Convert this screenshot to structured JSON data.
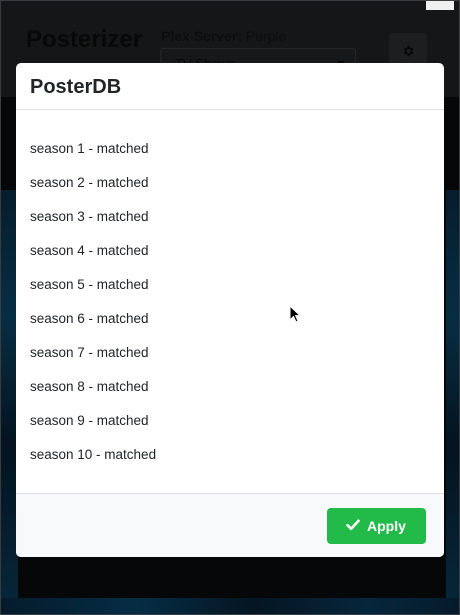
{
  "app": {
    "title": "Posterizer",
    "server_label": "Plex Server:",
    "server_name": "Purple",
    "library_select_value": "TV Shows"
  },
  "modal": {
    "title": "PosterDB",
    "items": [
      "season 1 - matched",
      "season 2 - matched",
      "season 3 - matched",
      "season 4 - matched",
      "season 5 - matched",
      "season 6 - matched",
      "season 7 - matched",
      "season 8 - matched",
      "season 9 - matched",
      "season 10 - matched"
    ],
    "apply_label": "Apply"
  },
  "icons": {
    "settings": "gear-icon",
    "apply": "check-icon",
    "cursor": "mouse-pointer-icon"
  },
  "colors": {
    "apply_button": "#22bb4a",
    "modal_background": "#ffffff",
    "footer_background": "#f8f9fa"
  }
}
